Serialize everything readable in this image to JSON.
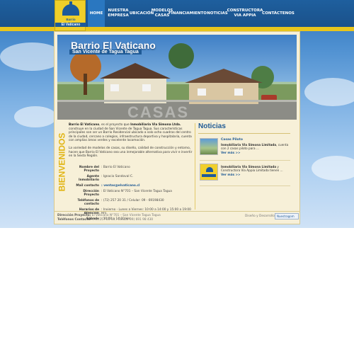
{
  "logo": {
    "line1": "Barrio",
    "line2": "El Vaticano"
  },
  "nav": {
    "items": [
      {
        "label": "HOME",
        "active": true
      },
      {
        "label": "NUESTRA\nEMPRESA",
        "active": false
      },
      {
        "label": "UBICACIÓN",
        "active": false
      },
      {
        "label": "MODELOS\nCASAS",
        "active": false
      },
      {
        "label": "FINANCIAMIENTO",
        "active": false
      },
      {
        "label": "NOTICIAS",
        "active": false
      },
      {
        "label": "CONSTRUCTORA\nVIA APPIA",
        "active": false
      },
      {
        "label": "CONTÁCTENOS",
        "active": false
      }
    ]
  },
  "hero": {
    "title": "Barrio El Vaticano",
    "subtitle": "San Vicente de Tagua Tagua",
    "watermark": "CASAS"
  },
  "section": {
    "side_label": "BIENVENIDOS"
  },
  "intro": {
    "p1_lead": "Barrio El Vaticano",
    "p1_mid": ", es el proyecto que ",
    "p1_company": "Inmobiliaria Via Simona Ltda.",
    "p1_rest": " construye en la ciudad de San Vicente de Tagua Tagua. Sus características principales son ser un Barrio Residencial ubicado a solo ocho cuadras del centro de la ciudad, cercano a colegios, infraestructura deportiva y hospitalaria, cuenta con amplias áreas verdes y excelente locomoción.",
    "p2": "La variedad de modelos de casas, su diseño, calidad de construcción y entorno, hacen que Barrio El Vaticano sea una inmejorable alternativa para vivir e invertir en la Sexta Región."
  },
  "details": [
    {
      "key": "Nombre del Proyecto",
      "value": ": Barrio El Vaticano",
      "link": false
    },
    {
      "key": "Agente Inmobiliario",
      "value": ": Ignacio Sandoval C.",
      "link": false
    },
    {
      "key": "Mail contacto",
      "value": ": ventas@elvaticano.cl",
      "link": true
    },
    {
      "key": "Dirección Proyecto",
      "value": ": El Vaticano N°701 – San Vicente Tagua Tagua",
      "link": false
    },
    {
      "key": "Teléfonos de contacto",
      "value": ": (72) 257 20 31 / Celular: 09 - 69198430",
      "link": false
    },
    {
      "key": "Horarios de Atención",
      "value": ": Invierno - Lunes a Viernes: 10:00 a 14:00 y 15:00 a 19:00 Hrs.",
      "link": false
    },
    {
      "key": "Sábado",
      "value": ": 10:00 a 14:00 Hrs",
      "link": false
    }
  ],
  "news": {
    "title": "Noticias",
    "items": [
      {
        "title": "Casas Piloto",
        "company": "Inmobiliaria Via Simona Limitada",
        "text": ", cuenta con 2 casas piloto para ...",
        "more": "Ver más >>"
      },
      {
        "title": "",
        "company": "Inmobiliaria Via Simona Limitada",
        "text": " y Constructora Via Appia Limitada tienen ...",
        "more": "Ver más >>"
      }
    ]
  },
  "footer": {
    "address_label": "Dirección Proyecto:",
    "address": " El Vaticano N°701 – San Vicente Tagua Tagua",
    "phone_label": "Teléfonos Contacto:",
    "phone": " (72) 257 20 31 / Celular 09) 691 98 430",
    "design": "Diseño y Desarrollo",
    "badge": "Nuestragom"
  },
  "colors": {
    "brand_blue": "#1f5a95",
    "brand_yellow": "#e8c51c",
    "content_bg": "#f7f0d8"
  }
}
